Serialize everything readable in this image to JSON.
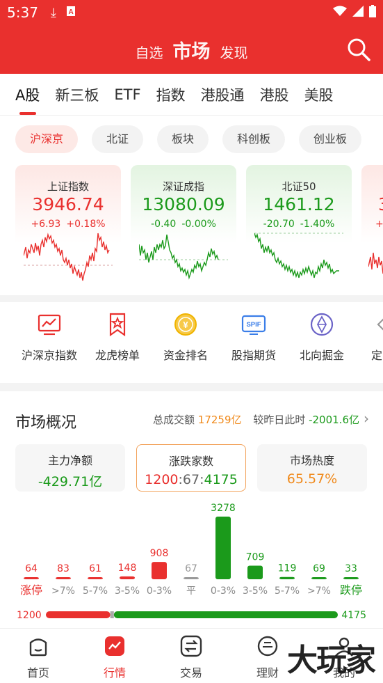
{
  "status": {
    "time": "5:37"
  },
  "top": {
    "tabs": [
      "自选",
      "市场",
      "发现"
    ]
  },
  "market_tabs": [
    "A股",
    "新三板",
    "ETF",
    "指数",
    "港股通",
    "港股",
    "美股"
  ],
  "chips": [
    "沪深京",
    "北证",
    "板块",
    "科创板",
    "创业板"
  ],
  "cards": [
    {
      "name": "上证指数",
      "value": "3946.74",
      "chg": "+6.93",
      "pct": "+0.18%",
      "trend": "up"
    },
    {
      "name": "深证成指",
      "value": "13080.09",
      "chg": "-0.40",
      "pct": "-0.00%",
      "trend": "down"
    },
    {
      "name": "北证50",
      "value": "1461.12",
      "chg": "-20.70",
      "pct": "-1.40%",
      "trend": "down"
    },
    {
      "name": "",
      "value": "3",
      "chg": "+",
      "pct": "",
      "trend": "up"
    }
  ],
  "tools": [
    "沪深京指数",
    "龙虎榜单",
    "资金排名",
    "股指期货",
    "北向掘金",
    "定"
  ],
  "overview": {
    "title": "市场概况",
    "turnover_label": "总成交额",
    "turnover_value": "17259亿",
    "compare_label": "较昨日此时",
    "compare_value": "-2001.6亿",
    "stats": [
      {
        "label": "主力净额",
        "value": "-429.71亿"
      },
      {
        "label": "涨跌家数",
        "value": [
          "1200",
          "67",
          "4175"
        ]
      },
      {
        "label": "市场热度",
        "value": "65.57%"
      }
    ]
  },
  "chart_data": {
    "type": "bar",
    "categories": [
      "涨停",
      ">7%",
      "5-7%",
      "3-5%",
      "0-3%",
      "平",
      "0-3%",
      "3-5%",
      "5-7%",
      ">7%",
      "跌停"
    ],
    "values": [
      64,
      83,
      61,
      148,
      908,
      67,
      3278,
      709,
      119,
      69,
      33
    ],
    "colors": [
      "#e9302e",
      "#e9302e",
      "#e9302e",
      "#e9302e",
      "#e9302e",
      "#999999",
      "#1b9a1b",
      "#1b9a1b",
      "#1b9a1b",
      "#1b9a1b",
      "#1b9a1b"
    ],
    "rise_total": "1200",
    "fall_total": "4175"
  },
  "tabbar": [
    "首页",
    "行情",
    "交易",
    "理财",
    "我的"
  ],
  "watermark": "大玩家"
}
